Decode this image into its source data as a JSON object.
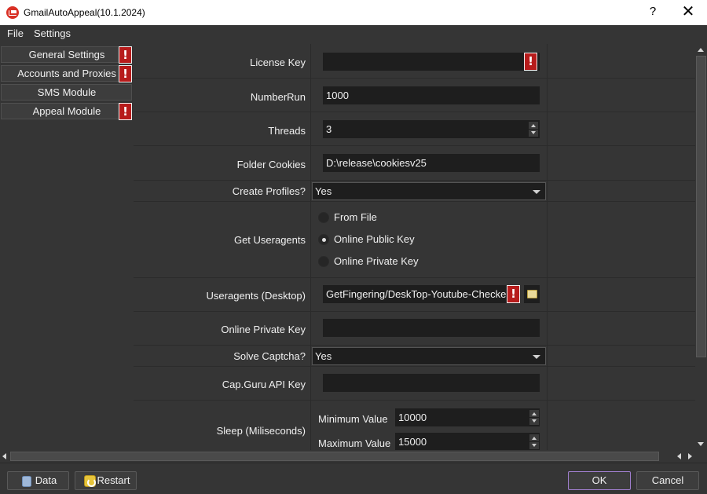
{
  "window": {
    "title": "GmailAutoAppeal(10.1.2024)",
    "help_glyph": "?",
    "close_glyph": "✕"
  },
  "menu": {
    "file": "File",
    "settings": "Settings"
  },
  "sidebar": {
    "items": [
      {
        "label": "General Settings",
        "warning": true
      },
      {
        "label": "Accounts and Proxies",
        "warning": true
      },
      {
        "label": "SMS Module",
        "warning": false
      },
      {
        "label": "Appeal Module",
        "warning": true
      }
    ],
    "warning_glyph": "!"
  },
  "form": {
    "license_key": {
      "label": "License Key",
      "value": ""
    },
    "number_run": {
      "label": "NumberRun",
      "value": "1000"
    },
    "threads": {
      "label": "Threads",
      "value": "3"
    },
    "folder_cookies": {
      "label": "Folder Cookies",
      "value": "D:\\release\\cookiesv25"
    },
    "create_profiles": {
      "label": "Create Profiles?",
      "value": "Yes"
    },
    "get_useragents": {
      "label": "Get Useragents",
      "options": [
        "From File",
        "Online Public Key",
        "Online Private Key"
      ],
      "selected": "Online Public Key"
    },
    "useragents_desktop": {
      "label": "Useragents (Desktop)",
      "value": "GetFingering/DeskTop-Youtube-Checked."
    },
    "online_private_key": {
      "label": "Online Private Key",
      "value": ""
    },
    "solve_captcha": {
      "label": "Solve Captcha?",
      "value": "Yes"
    },
    "capguru_api_key": {
      "label": "Cap.Guru API Key",
      "value": ""
    },
    "sleep": {
      "label": "Sleep (Miliseconds)",
      "min_label": "Minimum Value",
      "min_value": "10000",
      "max_label": "Maximum Value",
      "max_value": "15000"
    }
  },
  "footer": {
    "data_label": "Data",
    "restart_label": "Restart",
    "ok_label": "OK",
    "cancel_label": "Cancel"
  },
  "colors": {
    "warning_red": "#b71c1c",
    "ok_border": "#a17fcf",
    "background": "#353535",
    "field_background": "#1e1e1e"
  }
}
